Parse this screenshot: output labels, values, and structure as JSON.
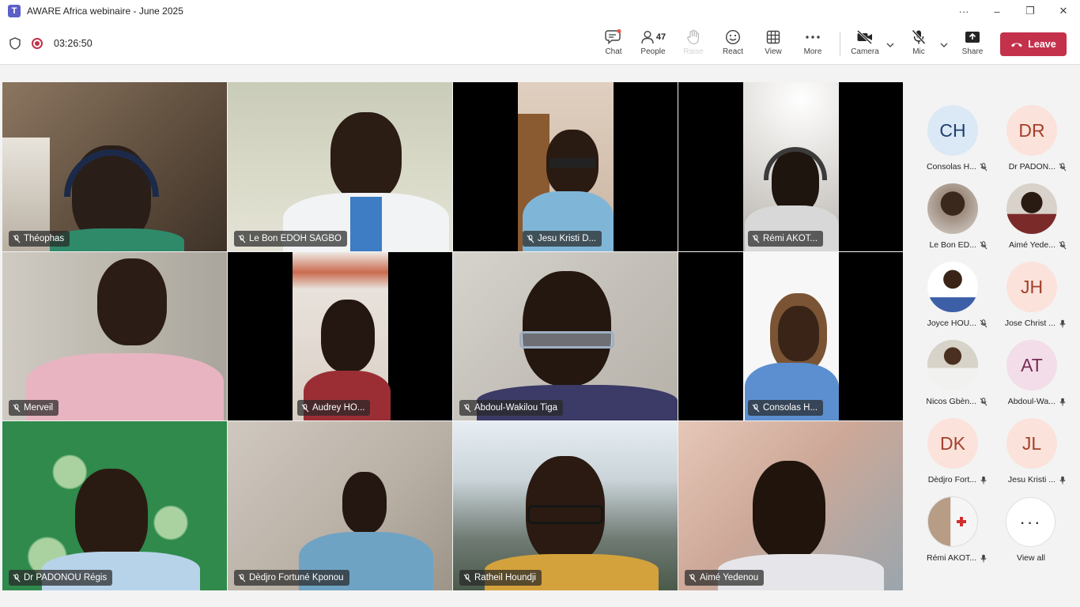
{
  "window": {
    "title": "AWARE Africa webinaire - June 2025",
    "logo_letter": "T",
    "more_glyph": "···",
    "minimize_glyph": "–",
    "maximize_glyph": "❐",
    "close_glyph": "✕"
  },
  "toolbar": {
    "timer": "03:26:50",
    "chat_label": "Chat",
    "people_label": "People",
    "people_count": "47",
    "raise_label": "Raise",
    "react_label": "React",
    "view_label": "View",
    "more_label": "More",
    "camera_label": "Camera",
    "mic_label": "Mic",
    "share_label": "Share",
    "leave_label": "Leave"
  },
  "tiles": [
    {
      "name": "Théophas"
    },
    {
      "name": "Le Bon EDOH SAGBO"
    },
    {
      "name": "Jesu Kristi D..."
    },
    {
      "name": "Rémi AKOT..."
    },
    {
      "name": "Merveil"
    },
    {
      "name": "Audrey HO..."
    },
    {
      "name": "Abdoul-Wakilou Tiga"
    },
    {
      "name": "Consolas H..."
    },
    {
      "name": "Dr PADONOU Régis"
    },
    {
      "name": "Dèdjro Fortuné Kponou"
    },
    {
      "name": "Ratheil Houndji"
    },
    {
      "name": "Aimé Yedenou"
    }
  ],
  "roster": [
    {
      "initials": "CH",
      "name": "Consolas H...",
      "mic": "muted",
      "avatar_bg": "#dbe8f5",
      "avatar_fg": "#1f3f6e"
    },
    {
      "initials": "DR",
      "name": "Dr PADON...",
      "mic": "muted",
      "avatar_bg": "#fbe2db",
      "avatar_fg": "#a3402a"
    },
    {
      "initials": "",
      "name": "Le Bon ED...",
      "mic": "muted",
      "avatar_bg": "#7c6a5c",
      "avatar_fg": "#ffffff"
    },
    {
      "initials": "",
      "name": "Aimé Yede...",
      "mic": "muted",
      "avatar_bg": "#5a4a40",
      "avatar_fg": "#ffffff"
    },
    {
      "initials": "",
      "name": "Joyce HOU...",
      "mic": "muted",
      "avatar_bg": "#ffffff",
      "avatar_fg": "#ffffff"
    },
    {
      "initials": "JH",
      "name": "Jose Christ ...",
      "mic": "on",
      "avatar_bg": "#fbe2db",
      "avatar_fg": "#a3402a"
    },
    {
      "initials": "",
      "name": "Nicos Gbèn...",
      "mic": "muted",
      "avatar_bg": "#d8d3c8",
      "avatar_fg": "#ffffff"
    },
    {
      "initials": "AT",
      "name": "Abdoul-Wa...",
      "mic": "on",
      "avatar_bg": "#f2dde9",
      "avatar_fg": "#7a2a55"
    },
    {
      "initials": "DK",
      "name": "Dèdjro Fort...",
      "mic": "on",
      "avatar_bg": "#fbe2db",
      "avatar_fg": "#a3402a"
    },
    {
      "initials": "JL",
      "name": "Jesu Kristi ...",
      "mic": "on",
      "avatar_bg": "#fbe2db",
      "avatar_fg": "#a3402a"
    },
    {
      "initials": "",
      "name": "Rémi AKOT...",
      "mic": "on",
      "avatar_bg": "#eaeaea",
      "avatar_fg": "#c4314b"
    }
  ],
  "view_all": {
    "label": "View all",
    "glyph": "···"
  }
}
